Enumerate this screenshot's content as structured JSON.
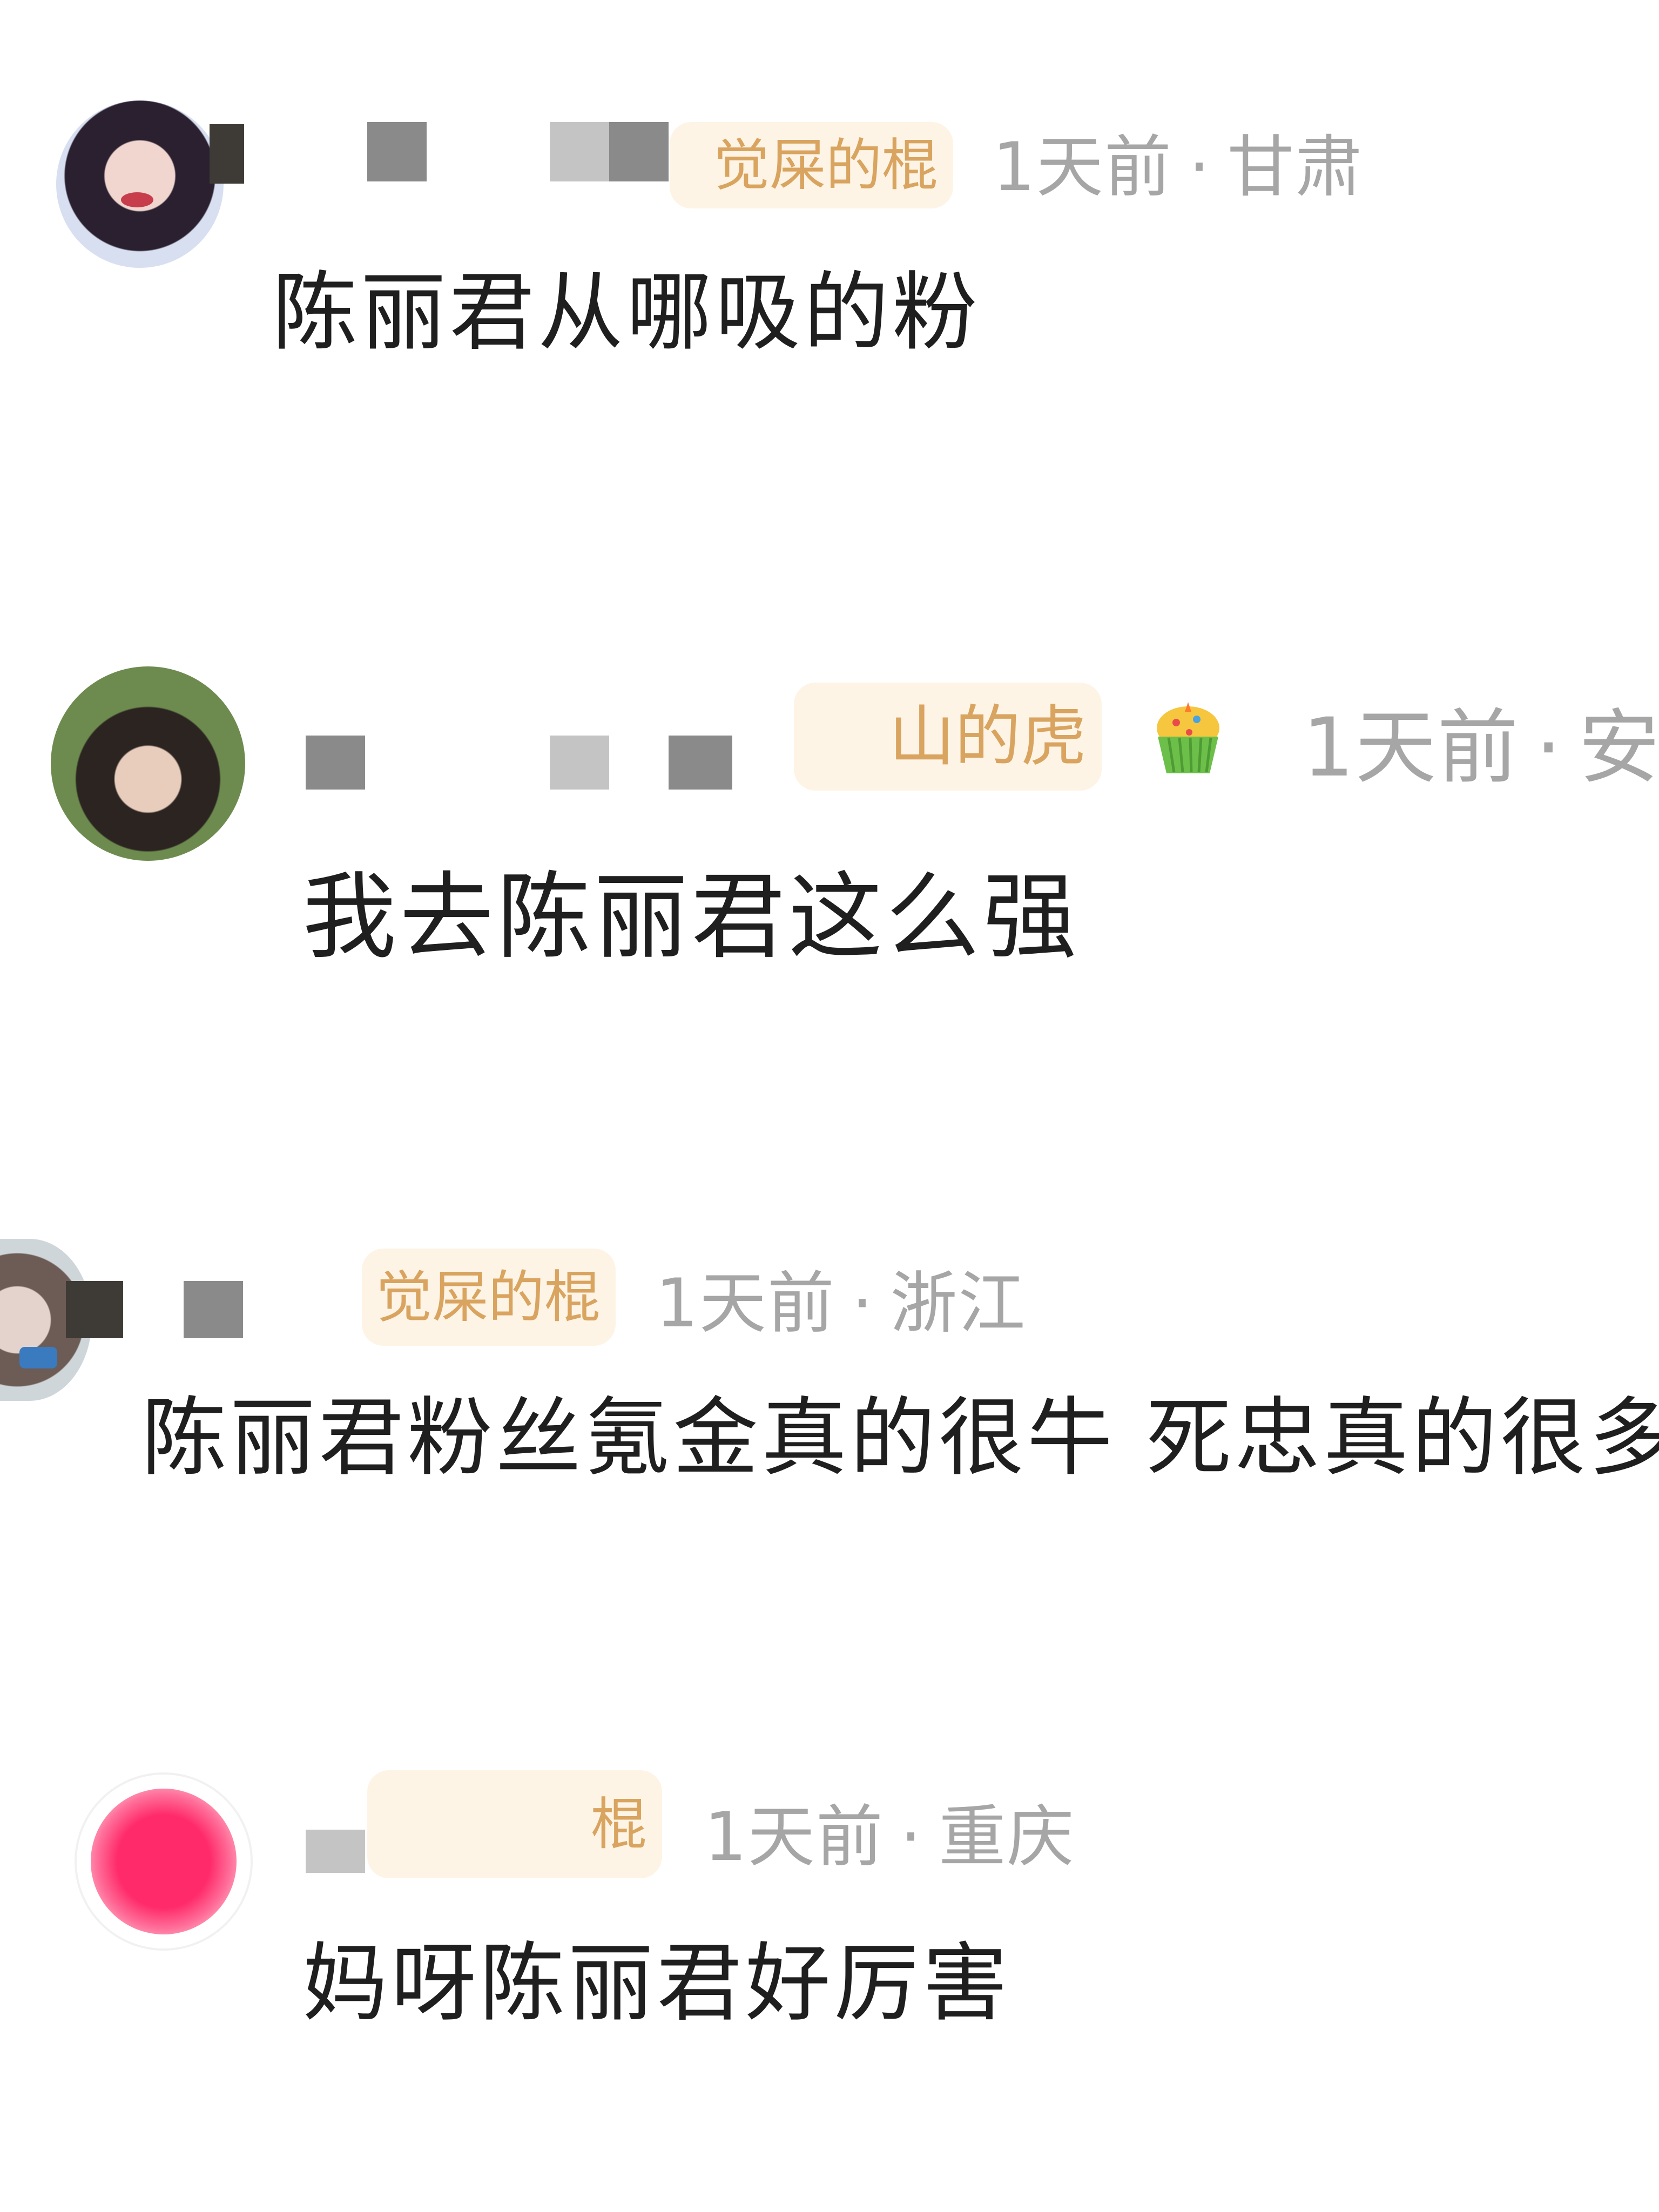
{
  "comments": [
    {
      "tag": "觉屎的棍",
      "time": "1天前",
      "location": "甘肃",
      "text": "陈丽君从哪吸的粉",
      "avatar_colors": [
        "#1d1c2a",
        "#e7c9c4",
        "#c73d4c"
      ]
    },
    {
      "tag": "山的虎",
      "badge_icon": "cupcake-icon",
      "time": "1天前",
      "location": "安",
      "text": "我去陈丽君这么强",
      "avatar_colors": [
        "#4f6b3a",
        "#2b2420",
        "#e8cdbd"
      ]
    },
    {
      "tag": "觉屎的棍",
      "time": "1天前",
      "location": "浙江",
      "text": "陈丽君粉丝氪金真的很牛 死忠真的很多",
      "avatar_colors": [
        "#6d5b55",
        "#e3d3cc",
        "#3a7bbf"
      ]
    },
    {
      "tag": "棍",
      "time": "1天前",
      "location": "重庆",
      "text": "妈呀陈丽君好厉害",
      "avatar_colors": [
        "#ff2a6a"
      ]
    }
  ],
  "dot": "·"
}
